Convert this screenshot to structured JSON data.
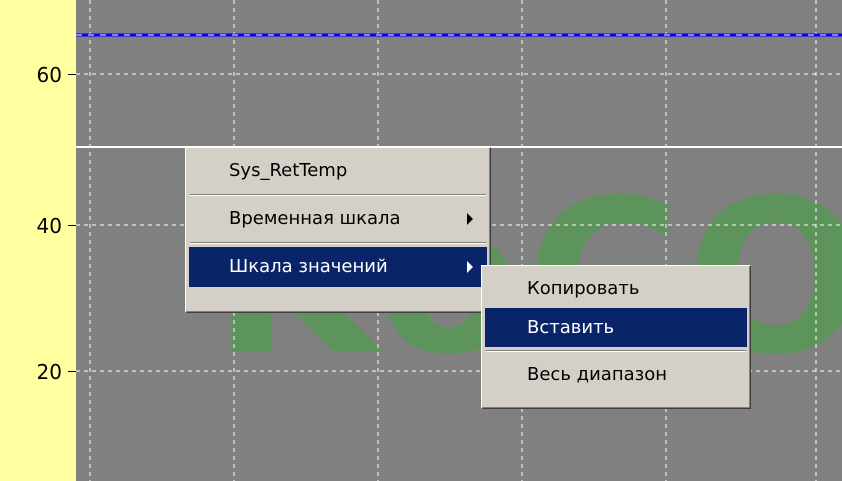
{
  "chart": {
    "y_ticks": [
      {
        "label": "60",
        "value": 60
      },
      {
        "label": "40",
        "value": 40
      },
      {
        "label": "20",
        "value": 20
      }
    ],
    "colors": {
      "plot_background": "#808080",
      "grid": "#ffffff",
      "axis_strip": "#ffffa0",
      "series_blue": "#0000ff",
      "series_white": "#ffffff",
      "watermark": "#3fa53f"
    },
    "watermark_text": "KoCO"
  },
  "context_menu": {
    "items": [
      {
        "label": "Sys_RetTemp",
        "has_submenu": false,
        "highlighted": false
      },
      {
        "label": "Временная шкала",
        "has_submenu": true,
        "highlighted": false
      },
      {
        "label": "Шкала значений",
        "has_submenu": true,
        "highlighted": true
      }
    ]
  },
  "submenu": {
    "items": [
      {
        "label": "Копировать",
        "highlighted": false
      },
      {
        "label": "Вставить",
        "highlighted": true
      },
      {
        "label": "Весь диапазон",
        "highlighted": false
      }
    ]
  },
  "menu_colors": {
    "face": "#d4d0c8",
    "highlight": "#0a246a",
    "highlight_text": "#ffffff"
  }
}
